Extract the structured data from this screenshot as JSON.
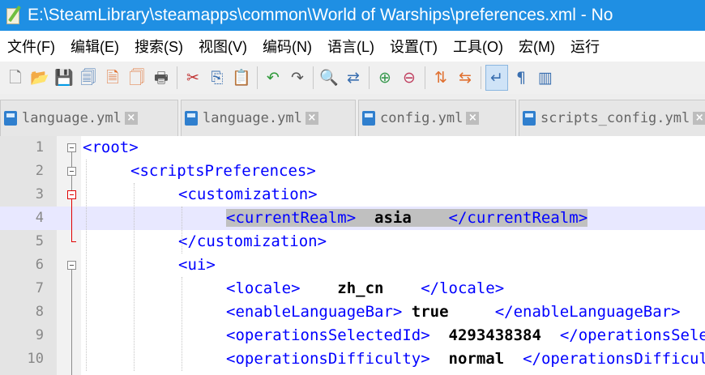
{
  "window": {
    "title": "E:\\SteamLibrary\\steamapps\\common\\World of Warships\\preferences.xml - No"
  },
  "menu": [
    "文件(F)",
    "编辑(E)",
    "搜索(S)",
    "视图(V)",
    "编码(N)",
    "语言(L)",
    "设置(T)",
    "工具(O)",
    "宏(M)",
    "运行"
  ],
  "toolbar": [
    {
      "icon": "new-file-icon",
      "glyph": "🗋",
      "color": "#777777"
    },
    {
      "icon": "open-file-icon",
      "glyph": "📂",
      "color": "#d8a330"
    },
    {
      "icon": "save-icon",
      "glyph": "💾",
      "color": "#555555"
    },
    {
      "icon": "save-all-icon",
      "glyph": "🗐",
      "color": "#3a6fb0"
    },
    {
      "icon": "close-icon",
      "glyph": "🗎",
      "color": "#e07030"
    },
    {
      "icon": "close-all-icon",
      "glyph": "🗍",
      "color": "#e07030"
    },
    {
      "icon": "print-icon",
      "glyph": "🖶",
      "color": "#555555"
    },
    {
      "sep": true
    },
    {
      "icon": "cut-icon",
      "glyph": "✂",
      "color": "#c03030"
    },
    {
      "icon": "copy-icon",
      "glyph": "⎘",
      "color": "#3a6fb0"
    },
    {
      "icon": "paste-icon",
      "glyph": "📋",
      "color": "#b08030"
    },
    {
      "sep": true
    },
    {
      "icon": "undo-icon",
      "glyph": "↶",
      "color": "#2f9a3a"
    },
    {
      "icon": "redo-icon",
      "glyph": "↷",
      "color": "#555555"
    },
    {
      "sep": true
    },
    {
      "icon": "find-icon",
      "glyph": "🔍",
      "color": "#333333"
    },
    {
      "icon": "replace-icon",
      "glyph": "⇄",
      "color": "#3a6fb0"
    },
    {
      "sep": true
    },
    {
      "icon": "zoom-in-icon",
      "glyph": "⊕",
      "color": "#3a9a50"
    },
    {
      "icon": "zoom-out-icon",
      "glyph": "⊖",
      "color": "#c04060"
    },
    {
      "sep": true
    },
    {
      "icon": "sync-vertical-icon",
      "glyph": "⇅",
      "color": "#e07030"
    },
    {
      "icon": "sync-horizontal-icon",
      "glyph": "⇆",
      "color": "#e07030"
    },
    {
      "sep": true
    },
    {
      "icon": "word-wrap-icon",
      "glyph": "↵",
      "color": "#3a6fb0",
      "selected": true
    },
    {
      "icon": "show-all-chars-icon",
      "glyph": "¶",
      "color": "#3a6fb0"
    },
    {
      "icon": "indent-guide-icon",
      "glyph": "▥",
      "color": "#3a6fb0"
    }
  ],
  "tabs": [
    {
      "label": "language.yml",
      "width": 210
    },
    {
      "label": "language.yml",
      "width": 206
    },
    {
      "label": "config.yml",
      "width": 185
    },
    {
      "label": "scripts_config.yml",
      "width": 270
    }
  ],
  "editor": {
    "lines": [
      {
        "num": "1",
        "indent": 0,
        "parts": [
          {
            "t": "<root>",
            "c": "tag"
          }
        ]
      },
      {
        "num": "2",
        "indent": 1,
        "parts": [
          {
            "t": "<scriptsPreferences>",
            "c": "tag"
          }
        ]
      },
      {
        "num": "3",
        "indent": 2,
        "parts": [
          {
            "t": "<customization>",
            "c": "tag"
          }
        ]
      },
      {
        "num": "4",
        "indent": 3,
        "current": true,
        "parts": [
          {
            "t": "<currentRealm>",
            "c": "tag hl"
          },
          {
            "t": "  asia    ",
            "c": "val hl"
          },
          {
            "t": "</currentRealm>",
            "c": "tag hl"
          }
        ]
      },
      {
        "num": "5",
        "indent": 2,
        "parts": [
          {
            "t": "</customization>",
            "c": "tag"
          }
        ]
      },
      {
        "num": "6",
        "indent": 2,
        "parts": [
          {
            "t": "<ui>",
            "c": "tag"
          }
        ]
      },
      {
        "num": "7",
        "indent": 3,
        "parts": [
          {
            "t": "<locale>",
            "c": "tag"
          },
          {
            "t": "    zh_cn    ",
            "c": "val"
          },
          {
            "t": "</locale>",
            "c": "tag"
          }
        ]
      },
      {
        "num": "8",
        "indent": 3,
        "parts": [
          {
            "t": "<enableLanguageBar>",
            "c": "tag"
          },
          {
            "t": " true     ",
            "c": "val"
          },
          {
            "t": "</enableLanguageBar>",
            "c": "tag"
          }
        ]
      },
      {
        "num": "9",
        "indent": 3,
        "parts": [
          {
            "t": "<operationsSelectedId>",
            "c": "tag"
          },
          {
            "t": "  4293438384  ",
            "c": "val"
          },
          {
            "t": "</operationsSelectedId>",
            "c": "tag"
          }
        ]
      },
      {
        "num": "10",
        "indent": 3,
        "parts": [
          {
            "t": "<operationsDifficulty>",
            "c": "tag"
          },
          {
            "t": "  normal  ",
            "c": "val"
          },
          {
            "t": "</operationsDifficulty>",
            "c": "tag"
          }
        ]
      }
    ]
  }
}
